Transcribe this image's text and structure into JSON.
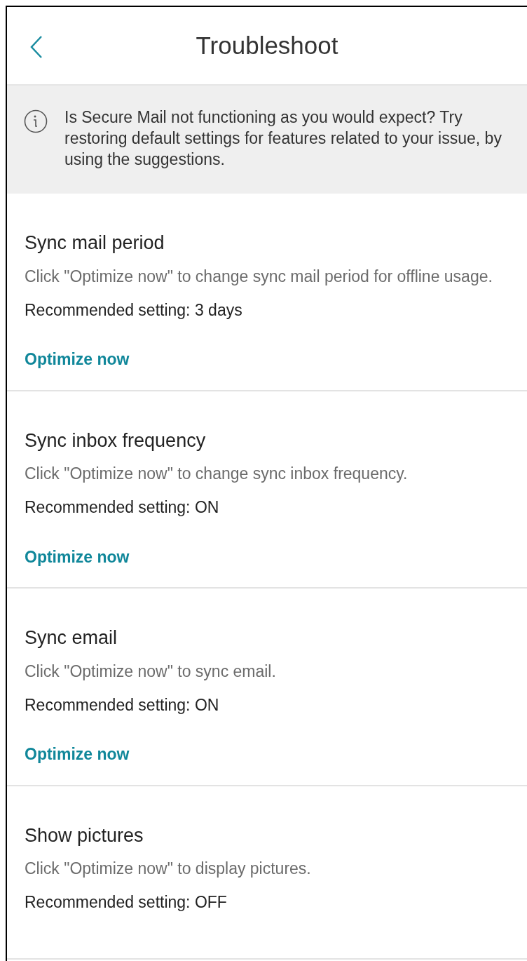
{
  "header": {
    "title": "Troubleshoot"
  },
  "info": {
    "text": "Is Secure Mail not functioning as you would expect? Try restoring default settings for features related to your issue, by using the suggestions."
  },
  "suggestions": [
    {
      "title": "Sync mail period",
      "description": "Click \"Optimize now\" to change sync mail period for offline usage.",
      "recommendation": "Recommended setting: 3 days",
      "action": "Optimize now"
    },
    {
      "title": "Sync inbox frequency",
      "description": "Click \"Optimize now\" to change sync inbox frequency.",
      "recommendation": "Recommended setting: ON",
      "action": "Optimize now"
    },
    {
      "title": "Sync email",
      "description": "Click \"Optimize now\" to sync email.",
      "recommendation": "Recommended setting: ON",
      "action": "Optimize now"
    },
    {
      "title": "Show pictures",
      "description": "Click \"Optimize now\" to display pictures.",
      "recommendation": "Recommended setting: OFF"
    }
  ]
}
